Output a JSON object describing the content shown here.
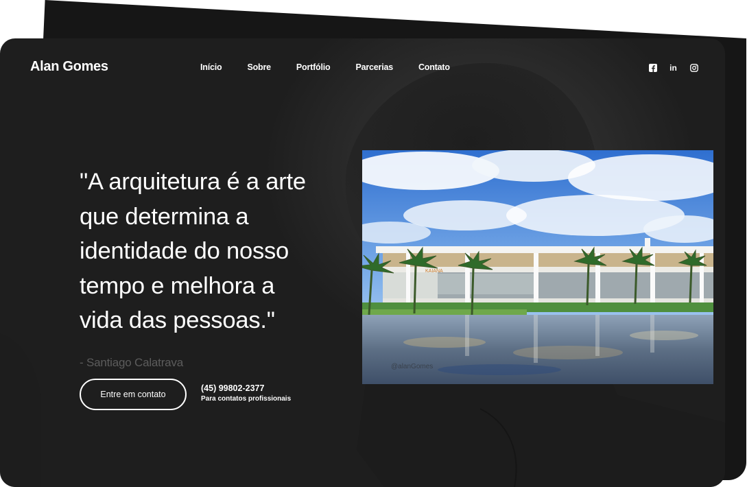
{
  "brand": "Alan Gomes",
  "nav": {
    "items": [
      {
        "label": "Início"
      },
      {
        "label": "Sobre"
      },
      {
        "label": "Portfólio"
      },
      {
        "label": "Parcerias"
      },
      {
        "label": "Contato"
      }
    ]
  },
  "social": [
    "facebook-icon",
    "linkedin-icon",
    "instagram-icon"
  ],
  "social_labels": {
    "linkedin": "in"
  },
  "hero": {
    "quote_lines": [
      "\"A arquitetura é a arte",
      "que determina a",
      "identidade do nosso",
      "tempo e melhora a",
      "vida das pessoas.\""
    ],
    "author": "- Santiago Calatrava",
    "cta_label": "Entre em contato",
    "phone": "(45) 99802-2377",
    "phone_note": "Para contatos profissionais"
  },
  "photo": {
    "sign_text": "KAIANA",
    "watermark": "@alanGomes"
  },
  "colors": {
    "background": "#ffffff",
    "card": "#232323",
    "text": "#ffffff",
    "muted": "#5c5c5c"
  }
}
